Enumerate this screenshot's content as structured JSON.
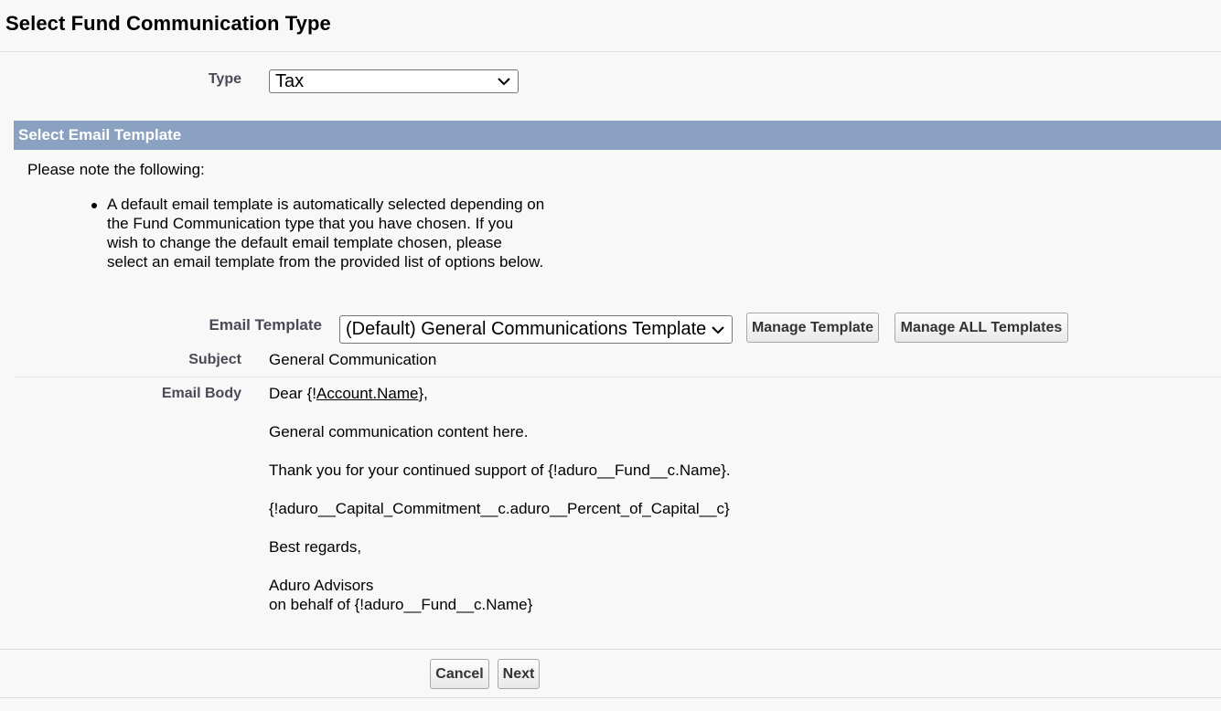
{
  "page_title": "Select Fund Communication Type",
  "type_field": {
    "label": "Type",
    "value": "Tax"
  },
  "section": {
    "title": "Select Email Template"
  },
  "note": {
    "intro": "Please note the following:",
    "bullets": [
      "A default email template is automatically selected depending on the Fund Communication type that you have chosen. If you wish to change the default email template chosen, please select an email template from the provided list of options below."
    ]
  },
  "email_template": {
    "label": "Email Template",
    "value": "(Default) General Communications Template",
    "manage_button": "Manage Template",
    "manage_all_button": "Manage ALL Templates"
  },
  "subject": {
    "label": "Subject",
    "value": "General Communication"
  },
  "email_body": {
    "label": "Email Body",
    "greeting_prefix": "Dear {!",
    "greeting_link": "Account.Name",
    "greeting_suffix": "},",
    "lines": [
      "General communication content here.",
      "Thank you for your continued support of {!aduro__Fund__c.Name}.",
      "{!aduro__Capital_Commitment__c.aduro__Percent_of_Capital__c}",
      "Best regards,",
      "Aduro Advisors",
      "on behalf of {!aduro__Fund__c.Name}"
    ]
  },
  "actions": {
    "cancel": "Cancel",
    "next": "Next"
  }
}
